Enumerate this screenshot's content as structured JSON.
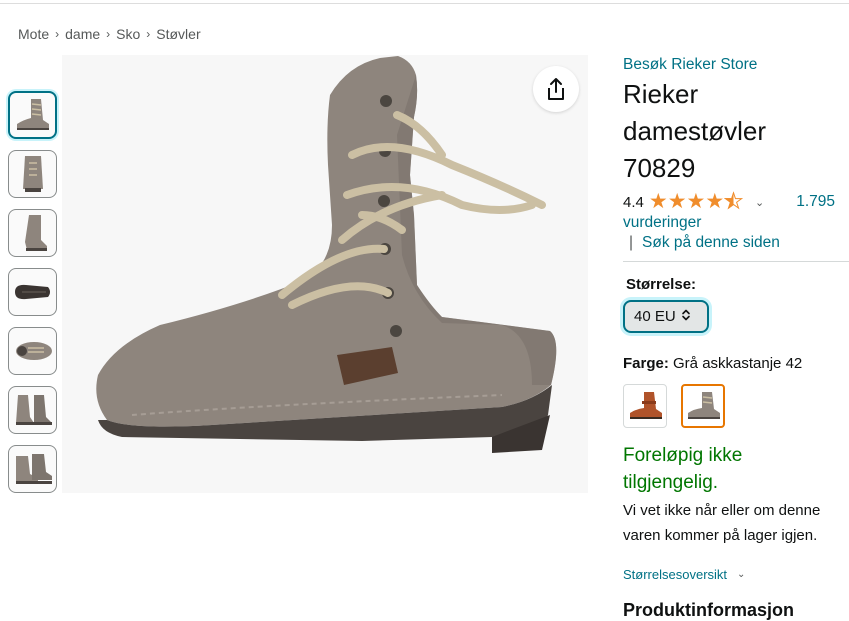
{
  "breadcrumb": [
    "Mote",
    "dame",
    "Sko",
    "Støvler"
  ],
  "breadcrumb_separator": "›",
  "thumbnails": [
    {
      "view": "side",
      "selected": true
    },
    {
      "view": "back"
    },
    {
      "view": "side-inner"
    },
    {
      "view": "sole"
    },
    {
      "view": "top"
    },
    {
      "view": "pair-front"
    },
    {
      "view": "pair-side"
    }
  ],
  "product": {
    "store_link": "Besøk Rieker Store",
    "title_lines": [
      "Rieker",
      "damestøvler",
      "70829"
    ],
    "rating": "4.4",
    "stars_full": 4,
    "stars_half": 1,
    "rating_count": "1.795",
    "reviews_word": "vurderinger",
    "search_separator": "|",
    "search_link": "Søk på denne siden"
  },
  "size": {
    "label": "Størrelse:",
    "selected": "40 EU"
  },
  "color": {
    "label": "Farge:",
    "value": "Grå askkastanje 42",
    "swatches": [
      {
        "name": "brown",
        "color": "#b0532a",
        "selected": false
      },
      {
        "name": "grey",
        "color": "#8e857d",
        "selected": true
      }
    ]
  },
  "availability": {
    "status_lines": [
      "Foreløpig ikke",
      "tilgjengelig."
    ],
    "note_lines": [
      "Vi vet ikke når eller om denne",
      "varen kommer på lager igjen."
    ]
  },
  "size_chart_link": "Størrelsesoversikt",
  "cutoff_heading": "Produktinformasjon",
  "colors": {
    "link": "#007185",
    "available": "#007600",
    "star": "#f08d2c",
    "boot": "#8e857d",
    "lace": "#cbbfa3"
  }
}
